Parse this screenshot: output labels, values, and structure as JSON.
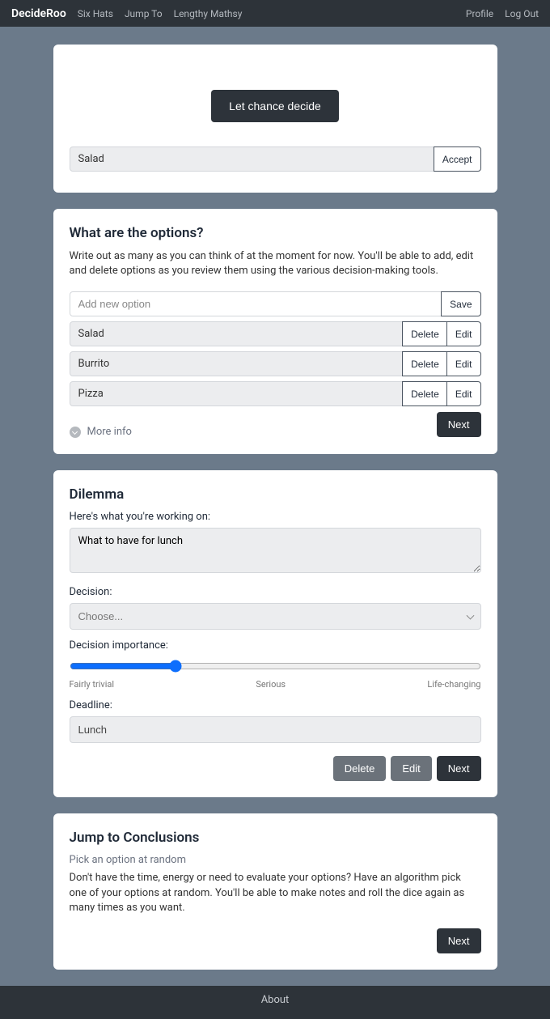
{
  "nav": {
    "brand": "DecideRoo",
    "links": [
      "Six Hats",
      "Jump To",
      "Lengthy Mathsy"
    ],
    "right": [
      "Profile",
      "Log Out"
    ]
  },
  "chance": {
    "button": "Let chance decide",
    "option": "Salad",
    "accept": "Accept"
  },
  "optionsCard": {
    "title": "What are the options?",
    "desc": "Write out as many as you can think of at the moment for now. You'll be able to add, edit and delete options as you review them using the various decision-making tools.",
    "placeholder": "Add new option",
    "save": "Save",
    "delete": "Delete",
    "edit": "Edit",
    "options": [
      "Salad",
      "Burrito",
      "Pizza"
    ],
    "moreInfo": "More info",
    "next": "Next"
  },
  "dilemma": {
    "title": "Dilemma",
    "workingOn": "Here's what you're working on:",
    "text": "What to have for lunch",
    "decisionLabel": "Decision:",
    "decisionPlaceholder": "Choose...",
    "importanceLabel": "Decision importance:",
    "rangeLabels": [
      "Fairly trivial",
      "Serious",
      "Life-changing"
    ],
    "deadlineLabel": "Deadline:",
    "deadlineValue": "Lunch",
    "delete": "Delete",
    "edit": "Edit",
    "next": "Next"
  },
  "jump": {
    "title": "Jump to Conclusions",
    "sub": "Pick an option at random",
    "desc": "Don't have the time, energy or need to evaluate your options? Have an algorithm pick one of your options at random. You'll be able to make notes and roll the dice again as many times as you want.",
    "next": "Next"
  },
  "footer": {
    "about": "About"
  }
}
